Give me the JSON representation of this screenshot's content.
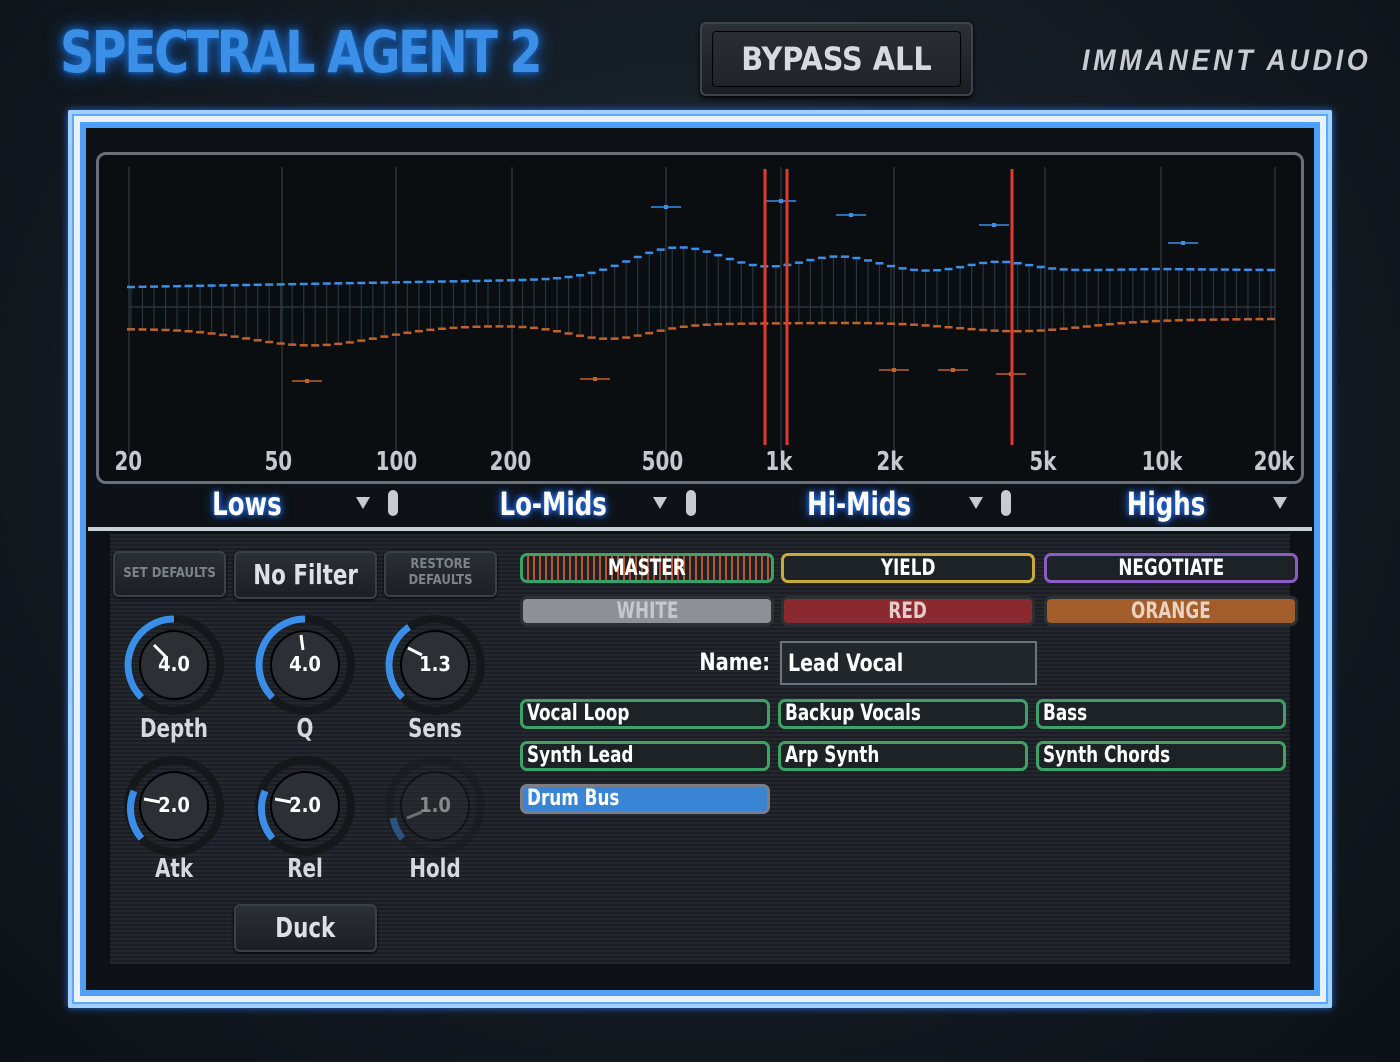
{
  "header": {
    "title": "SPECTRAL AGENT 2",
    "bypass_label": "BYPASS ALL",
    "brand": "IMMANENT AUDIO"
  },
  "spectrum": {
    "freq_labels": [
      "20",
      "50",
      "100",
      "200",
      "500",
      "1k",
      "2k",
      "5k",
      "10k",
      "20k"
    ],
    "bands": [
      {
        "name": "Lows"
      },
      {
        "name": "Lo-Mids"
      },
      {
        "name": "Hi-Mids"
      },
      {
        "name": "Highs"
      }
    ],
    "colors": {
      "boost": "#3b8fe6",
      "cut": "#c0622a",
      "marker": "#e03a2e"
    }
  },
  "controls": {
    "set_defaults": "SET DEFAULTS",
    "filter": "No Filter",
    "restore_line1": "RESTORE",
    "restore_line2": "DEFAULTS",
    "duck": "Duck",
    "knobs": [
      {
        "label": "Depth",
        "value": "4.0"
      },
      {
        "label": "Q",
        "value": "4.0"
      },
      {
        "label": "Sens",
        "value": "1.3"
      },
      {
        "label": "Atk",
        "value": "2.0"
      },
      {
        "label": "Rel",
        "value": "2.0"
      },
      {
        "label": "Hold",
        "value": "1.0"
      }
    ]
  },
  "groups": {
    "row1": [
      "MASTER",
      "YIELD",
      "NEGOTIATE"
    ],
    "row2": [
      "WHITE",
      "RED",
      "ORANGE"
    ]
  },
  "name_field": {
    "label": "Name:",
    "value": "Lead Vocal"
  },
  "tracks": [
    "Vocal Loop",
    "Backup Vocals",
    "Bass",
    "Synth Lead",
    "Arp Synth",
    "Synth Chords",
    "Drum Bus"
  ],
  "selected_track": "Drum Bus"
}
